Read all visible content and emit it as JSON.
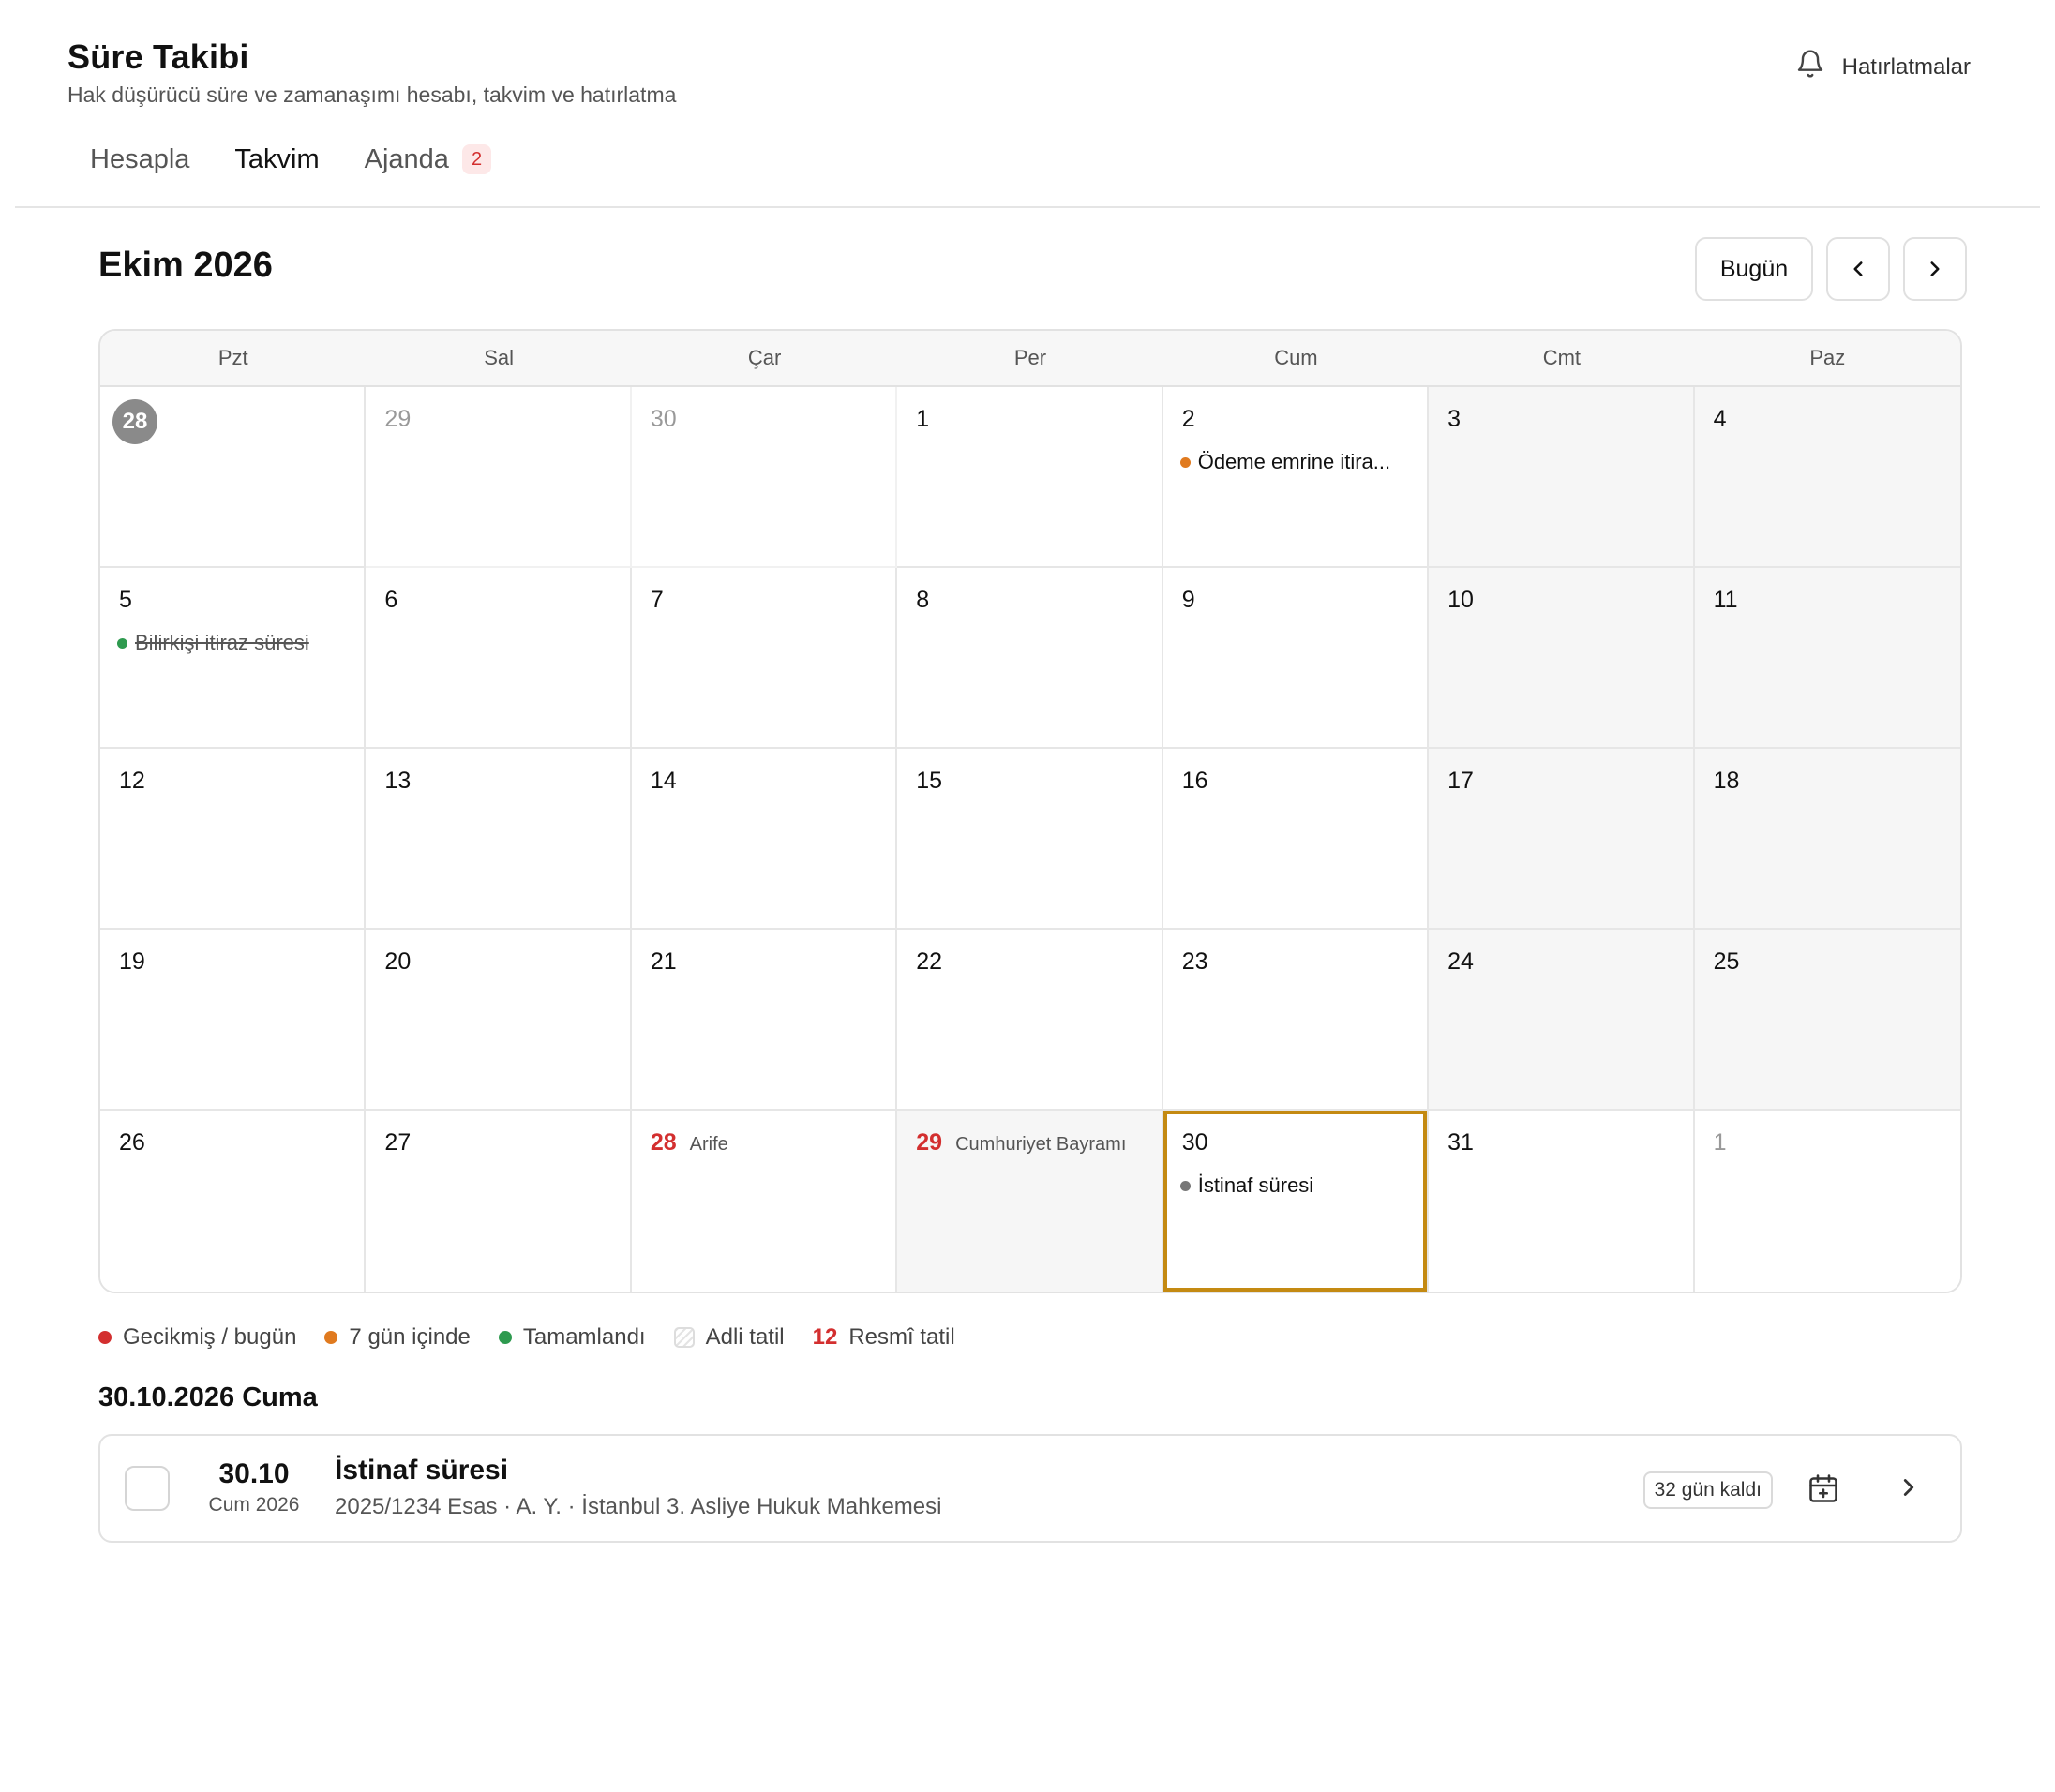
{
  "header": {
    "title": "Süre Takibi",
    "subtitle": "Hak düşürücü süre ve zamanaşımı hesabı, takvim ve hatırlatma",
    "reminders_label": "Hatırlatmalar"
  },
  "tabs": [
    {
      "label": "Hesapla",
      "active": false
    },
    {
      "label": "Takvim",
      "active": true
    },
    {
      "label": "Ajanda",
      "active": false,
      "badge": "2"
    }
  ],
  "calendar": {
    "month_title": "Ekim 2026",
    "today_button": "Bugün",
    "weekdays": [
      "Pzt",
      "Sal",
      "Çar",
      "Per",
      "Cum",
      "Cmt",
      "Paz"
    ],
    "weeks": [
      [
        {
          "day": "28",
          "today": true,
          "other": false
        },
        {
          "day": "29",
          "other": true
        },
        {
          "day": "30",
          "other": true
        },
        {
          "day": "1"
        },
        {
          "day": "2",
          "events": [
            {
              "title": "Ödeme emrine itira...",
              "color": "#e07a1f",
              "done": false
            }
          ]
        },
        {
          "day": "3",
          "weekend": true
        },
        {
          "day": "4",
          "weekend": true
        }
      ],
      [
        {
          "day": "5",
          "events": [
            {
              "title": "Bilirkişi itiraz süresi",
              "color": "#2e9a4f",
              "done": true
            }
          ]
        },
        {
          "day": "6"
        },
        {
          "day": "7"
        },
        {
          "day": "8"
        },
        {
          "day": "9"
        },
        {
          "day": "10",
          "weekend": true
        },
        {
          "day": "11",
          "weekend": true
        }
      ],
      [
        {
          "day": "12"
        },
        {
          "day": "13"
        },
        {
          "day": "14"
        },
        {
          "day": "15"
        },
        {
          "day": "16"
        },
        {
          "day": "17",
          "weekend": true
        },
        {
          "day": "18",
          "weekend": true
        }
      ],
      [
        {
          "day": "19"
        },
        {
          "day": "20"
        },
        {
          "day": "21"
        },
        {
          "day": "22"
        },
        {
          "day": "23"
        },
        {
          "day": "24",
          "weekend": true
        },
        {
          "day": "25",
          "weekend": true
        }
      ],
      [
        {
          "day": "26"
        },
        {
          "day": "27"
        },
        {
          "day": "28",
          "holiday": "Arife"
        },
        {
          "day": "29",
          "holiday": "Cumhuriyet Bayramı",
          "shade": true
        },
        {
          "day": "30",
          "selected": true,
          "events": [
            {
              "title": "İstinaf süresi",
              "color": "#777777",
              "done": false
            }
          ]
        },
        {
          "day": "31"
        },
        {
          "day": "1",
          "other": true
        }
      ]
    ]
  },
  "legend": [
    {
      "kind": "dot",
      "color": "#d32f2f",
      "label": "Gecikmiş / bugün"
    },
    {
      "kind": "dot",
      "color": "#e07a1f",
      "label": "7 gün içinde"
    },
    {
      "kind": "dot",
      "color": "#2e9a4f",
      "label": "Tamamlandı"
    },
    {
      "kind": "hatch",
      "label": "Adli tatil"
    },
    {
      "kind": "num",
      "num": "12",
      "label": "Resmî tatil"
    }
  ],
  "agenda": {
    "heading": "30.10.2026 Cuma",
    "item": {
      "date_dm": "30.10",
      "date_wy": "Cum 2026",
      "title": "İstinaf süresi",
      "meta": "2025/1234 Esas · A. Y. · İstanbul 3. Asliye Hukuk Mahkemesi",
      "remaining": "32 gün kaldı"
    }
  },
  "icons": {
    "reminders": "bell-icon",
    "prev": "chevron-left-icon",
    "next": "chevron-right-icon",
    "add_to_calendar": "calendar-plus-icon",
    "open": "chevron-right-icon"
  },
  "colors": {
    "selected_border": "#c48a12",
    "holiday_red": "#d32f2f"
  }
}
